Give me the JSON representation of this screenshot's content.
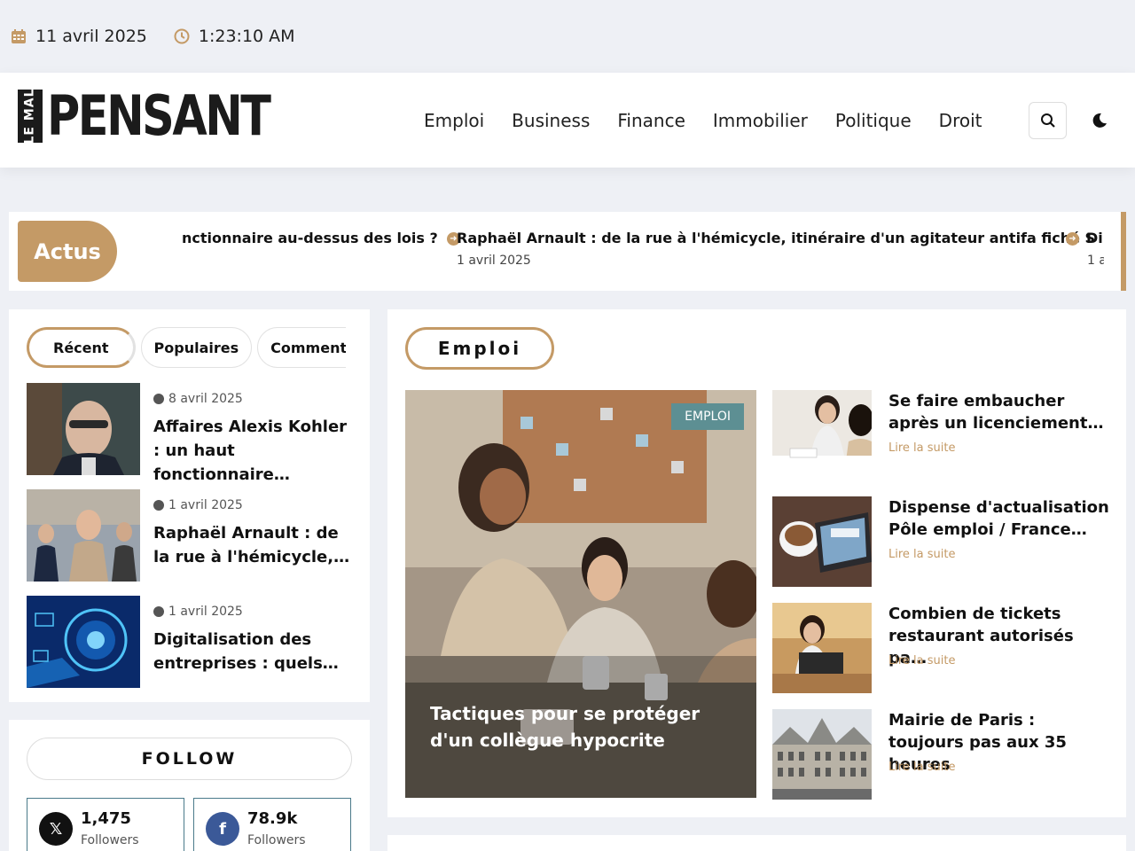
{
  "topbar": {
    "date": "11 avril 2025",
    "time": "1:23:10 AM"
  },
  "header": {
    "logo_small": "LE MAL",
    "logo_big": "PENSANT",
    "nav": [
      "Emploi",
      "Business",
      "Finance",
      "Immobilier",
      "Politique",
      "Droit"
    ]
  },
  "ticker": {
    "label": "Actus",
    "items": [
      {
        "title": "nctionnaire au-dessus des lois ?",
        "date": ""
      },
      {
        "title": "Raphaël Arnault : de la rue à l'hémicycle, itinéraire d'un agitateur antifa fiché S",
        "date": "1 avril 2025"
      },
      {
        "title": "Di",
        "date": "1 a"
      }
    ]
  },
  "sidebar": {
    "tabs": [
      "Récent",
      "Populaires",
      "Commentaires"
    ],
    "posts": [
      {
        "date": "8 avril 2025",
        "title": "Affaires Alexis Kohler : un haut fonctionnaire…"
      },
      {
        "date": "1 avril 2025",
        "title": "Raphaël Arnault : de la rue à l'hémicycle,…"
      },
      {
        "date": "1 avril 2025",
        "title": "Digitalisation des entreprises : quels…"
      }
    ],
    "follow": {
      "title": "FOLLOW",
      "accounts": [
        {
          "network": "x-icon",
          "count": "1,475",
          "label": "Followers",
          "color": "#111111"
        },
        {
          "network": "facebook-icon",
          "count": "78.9k",
          "label": "Followers",
          "color": "#3b5998"
        }
      ]
    }
  },
  "main": {
    "section_title": "Emploi",
    "hero": {
      "badge": "EMPLOI",
      "title": "Tactiques pour se protéger d'un collègue hypocrite"
    },
    "side_posts": [
      {
        "title": "Se faire embaucher après un licenciement…",
        "more": "Lire la suite"
      },
      {
        "title": "Dispense d'actualisation Pôle emploi / France…",
        "more": "Lire la suite"
      },
      {
        "title": "Combien de tickets restaurant autorisés pa…",
        "more": "Lire la suite"
      },
      {
        "title": "Mairie de Paris : toujours pas aux 35 heures",
        "more": "Lire la suite"
      }
    ]
  },
  "colors": {
    "accent": "#c49a66",
    "badge": "#5d8f93",
    "background": "#eef0f5"
  }
}
